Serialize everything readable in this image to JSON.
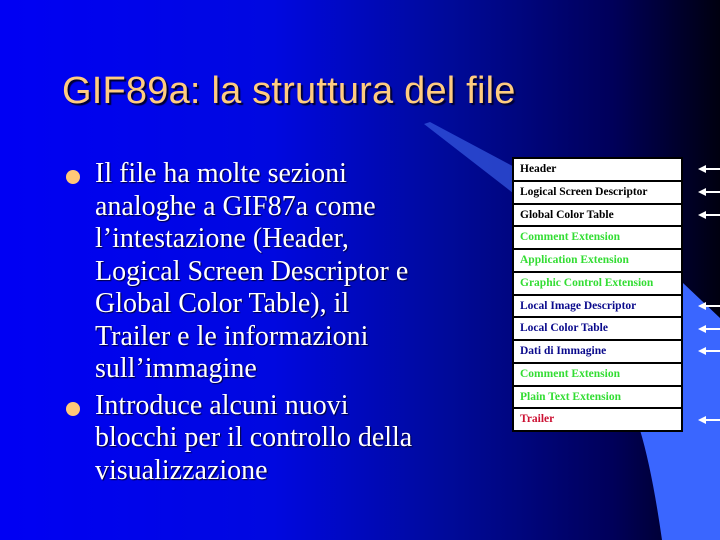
{
  "slide": {
    "title": "GIF89a: la struttura del file",
    "colors": {
      "title": "#ffcc80",
      "bullet_dot": "#ffc878",
      "body_text": "#ffffff",
      "accent_wedge": "#3a66ff"
    },
    "bullets": [
      {
        "lines": [
          "Il file ha molte sezioni",
          "analoghe a GIF87a come",
          "l’intestazione (Header,",
          "Logical Screen Descriptor e",
          "Global Color Table), il",
          "Trailer e le informazioni",
          "sull’immagine"
        ]
      },
      {
        "lines": [
          "Introduce alcuni nuovi",
          "blocchi per il controllo della",
          "visualizzazione"
        ]
      }
    ],
    "structure_table": {
      "rows": [
        {
          "label": "Header",
          "color": "#000000",
          "arrow": true
        },
        {
          "label": "Logical Screen Descriptor",
          "color": "#000000",
          "arrow": true
        },
        {
          "label": "Global Color Table",
          "color": "#000000",
          "arrow": true
        },
        {
          "label": "Comment Extension",
          "color": "#33dd33",
          "arrow": false
        },
        {
          "label": "Application Extension",
          "color": "#33dd33",
          "arrow": false
        },
        {
          "label": "Graphic Control Extension",
          "color": "#33dd33",
          "arrow": false
        },
        {
          "label": "Local Image Descriptor",
          "color": "#0a0a8c",
          "arrow": true
        },
        {
          "label": "Local Color Table",
          "color": "#0a0a8c",
          "arrow": true
        },
        {
          "label": "Dati di Immagine",
          "color": "#0a0a8c",
          "arrow": true
        },
        {
          "label": "Comment Extension",
          "color": "#33dd33",
          "arrow": false
        },
        {
          "label": "Plain Text Extension",
          "color": "#33dd33",
          "arrow": false
        },
        {
          "label": "Trailer",
          "color": "#cc1133",
          "arrow": true
        }
      ]
    }
  }
}
